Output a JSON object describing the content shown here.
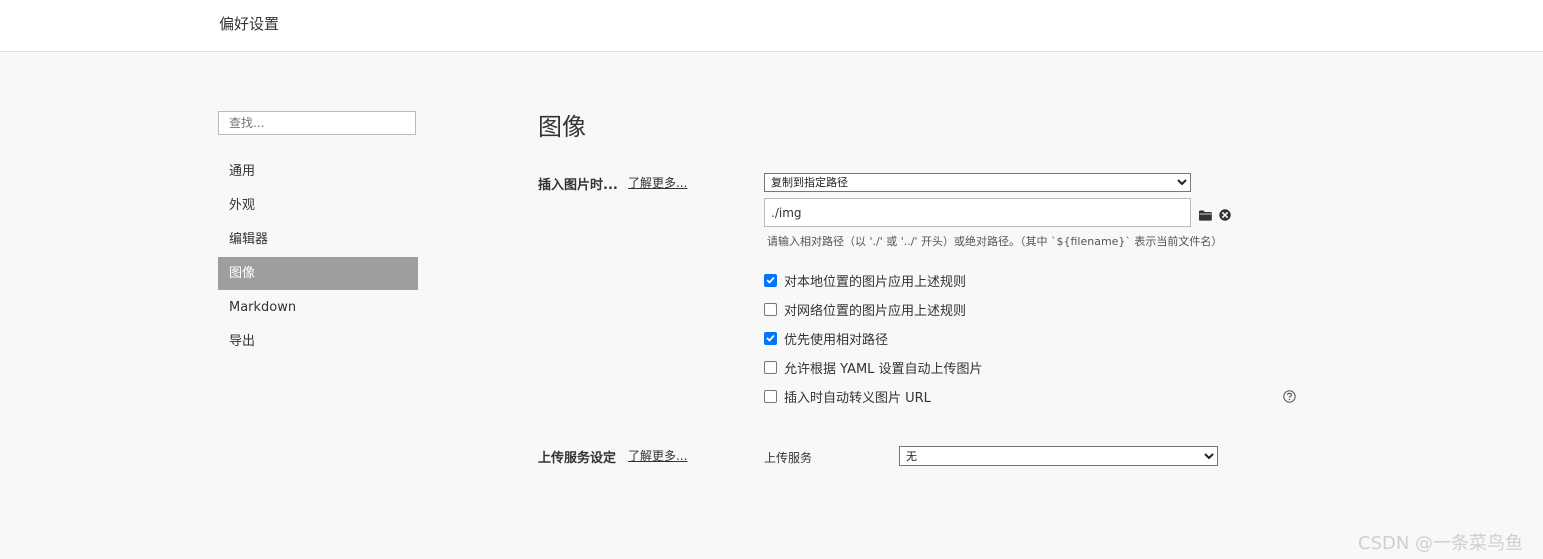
{
  "window": {
    "title": "偏好设置"
  },
  "search": {
    "placeholder": "查找..."
  },
  "sidebar": {
    "items": [
      {
        "label": "通用"
      },
      {
        "label": "外观"
      },
      {
        "label": "编辑器"
      },
      {
        "label": "图像",
        "active": true
      },
      {
        "label": "Markdown"
      },
      {
        "label": "导出"
      }
    ]
  },
  "main": {
    "title": "图像",
    "insert_image": {
      "label": "插入图片时...",
      "learn_more": "了解更多...",
      "action_selected": "复制到指定路径",
      "path_value": "./img",
      "hint": "请输入相对路径（以 './' 或 '../' 开头）或绝对路径。（其中 `${filename}` 表示当前文件名）",
      "options": [
        {
          "label": "对本地位置的图片应用上述规则",
          "checked": true
        },
        {
          "label": "对网络位置的图片应用上述规则",
          "checked": false
        },
        {
          "label": "优先使用相对路径",
          "checked": true
        },
        {
          "label": "允许根据 YAML 设置自动上传图片",
          "checked": false
        },
        {
          "label": "插入时自动转义图片 URL",
          "checked": false
        }
      ]
    },
    "upload": {
      "label": "上传服务设定",
      "learn_more": "了解更多...",
      "service_label": "上传服务",
      "service_selected": "无"
    }
  },
  "watermark": "CSDN @一条菜鸟鱼",
  "colors": {
    "active_nav_bg": "#9e9e9e",
    "checkbox_checked": "#0075ff"
  }
}
